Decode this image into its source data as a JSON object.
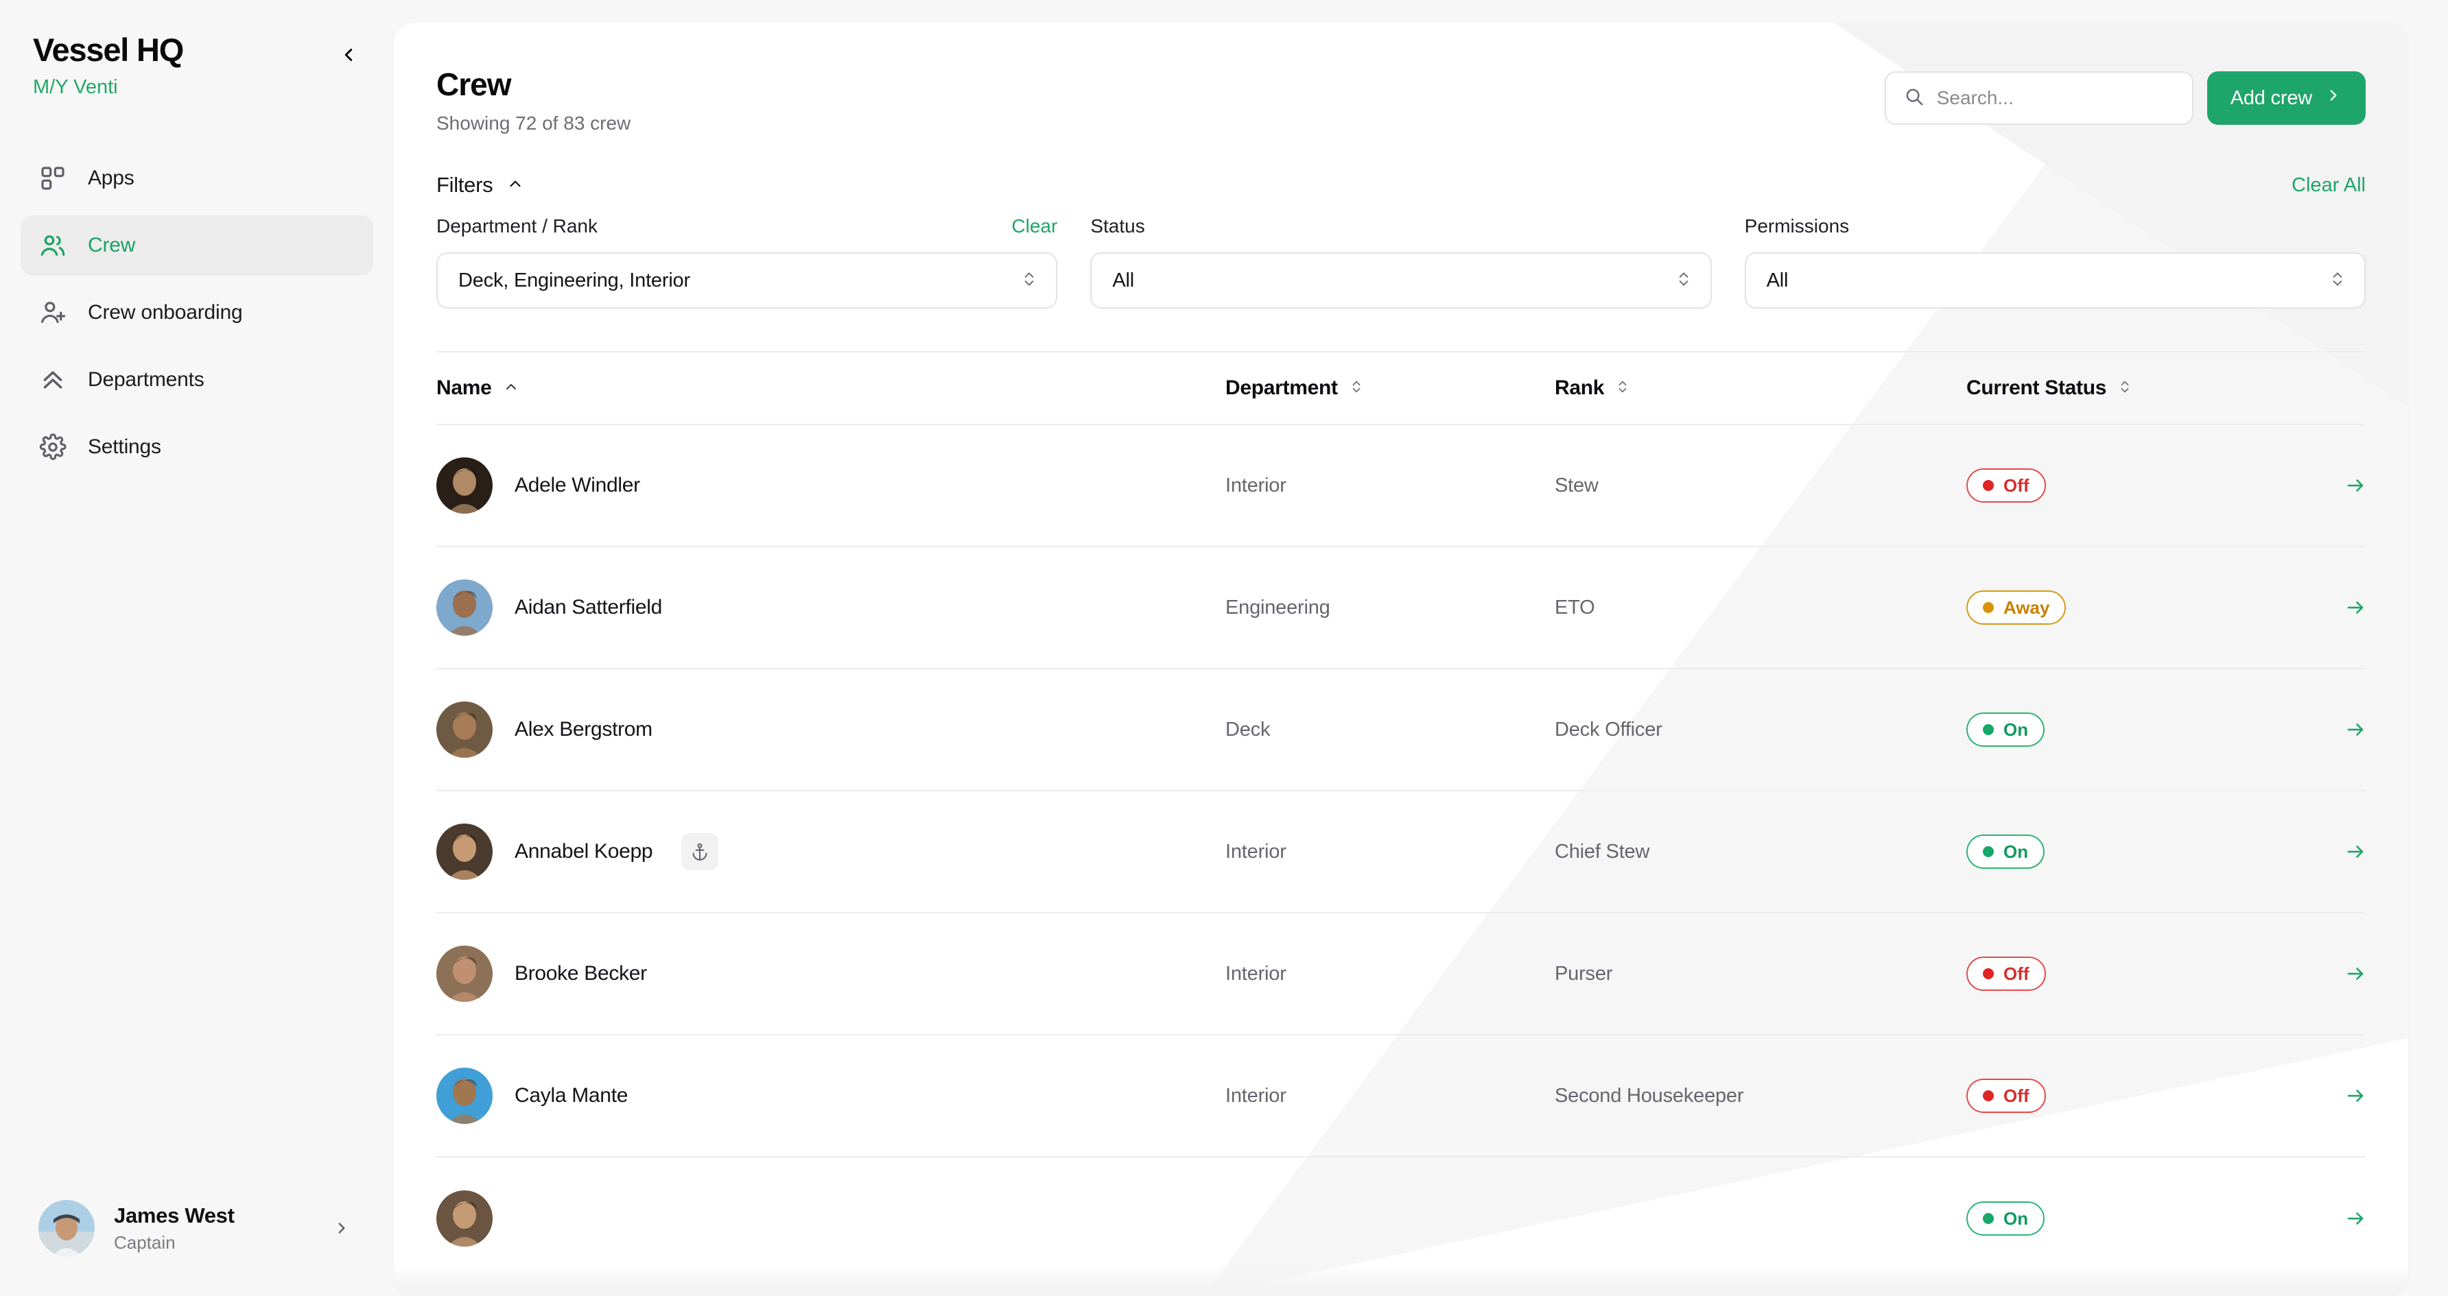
{
  "sidebar": {
    "brand_title": "Vessel HQ",
    "brand_subtitle": "M/Y Venti",
    "collapse_icon": "chevron-left-icon",
    "items": [
      {
        "label": "Apps",
        "icon": "apps-grid-icon",
        "active": false
      },
      {
        "label": "Crew",
        "icon": "users-icon",
        "active": true
      },
      {
        "label": "Crew onboarding",
        "icon": "user-plus-icon",
        "active": false
      },
      {
        "label": "Departments",
        "icon": "double-chevron-up-icon",
        "active": false
      },
      {
        "label": "Settings",
        "icon": "gear-icon",
        "active": false
      }
    ],
    "user": {
      "name": "James West",
      "role": "Captain",
      "chevron_icon": "chevron-right-icon"
    }
  },
  "header": {
    "title": "Crew",
    "subtitle": "Showing 72 of 83 crew",
    "search": {
      "placeholder": "Search...",
      "value": "",
      "icon": "search-icon"
    },
    "add_button": {
      "label": "Add crew",
      "icon": "chevron-right-icon"
    }
  },
  "filters": {
    "label": "Filters",
    "toggle_icon": "chevron-up-icon",
    "clear_all_label": "Clear All",
    "fields": [
      {
        "label": "Department / Rank",
        "clear_label": "Clear",
        "value": "Deck, Engineering, Interior",
        "icon": "chevron-updown-icon"
      },
      {
        "label": "Status",
        "clear_label": "",
        "value": "All",
        "icon": "chevron-updown-icon"
      },
      {
        "label": "Permissions",
        "clear_label": "",
        "value": "All",
        "icon": "chevron-updown-icon"
      }
    ]
  },
  "table": {
    "columns": [
      {
        "label": "Name",
        "sort_icon": "chevron-up-icon",
        "sorted": true
      },
      {
        "label": "Department",
        "sort_icon": "chevron-updown-icon",
        "sorted": false
      },
      {
        "label": "Rank",
        "sort_icon": "chevron-updown-icon",
        "sorted": false
      },
      {
        "label": "Current Status",
        "sort_icon": "chevron-updown-icon",
        "sorted": false
      }
    ],
    "row_arrow_icon": "arrow-right-icon",
    "rows": [
      {
        "name": "Adele Windler",
        "department": "Interior",
        "rank": "Stew",
        "status": "Off",
        "status_kind": "off",
        "badge_icon": null,
        "avatar_tone": "#b08a64",
        "avatar_bg": "#2a1f18"
      },
      {
        "name": "Aidan Satterfield",
        "department": "Engineering",
        "rank": "ETO",
        "status": "Away",
        "status_kind": "away",
        "badge_icon": null,
        "avatar_tone": "#9c6f4e",
        "avatar_bg": "#7ea8cc"
      },
      {
        "name": "Alex Bergstrom",
        "department": "Deck",
        "rank": "Deck Officer",
        "status": "On",
        "status_kind": "on",
        "badge_icon": null,
        "avatar_tone": "#a87c57",
        "avatar_bg": "#6f5b44"
      },
      {
        "name": "Annabel Koepp",
        "department": "Interior",
        "rank": "Chief Stew",
        "status": "On",
        "status_kind": "on",
        "badge_icon": "anchor-icon",
        "avatar_tone": "#c79a73",
        "avatar_bg": "#4b3b2e"
      },
      {
        "name": "Brooke Becker",
        "department": "Interior",
        "rank": "Purser",
        "status": "Off",
        "status_kind": "off",
        "badge_icon": null,
        "avatar_tone": "#c09071",
        "avatar_bg": "#8d7157"
      },
      {
        "name": "Cayla Mante",
        "department": "Interior",
        "rank": "Second Housekeeper",
        "status": "Off",
        "status_kind": "off",
        "badge_icon": null,
        "avatar_tone": "#a2764f",
        "avatar_bg": "#3f9fd6"
      },
      {
        "name": "",
        "department": "",
        "rank": "",
        "status": "On",
        "status_kind": "on",
        "badge_icon": null,
        "avatar_tone": "#c49b74",
        "avatar_bg": "#6b5440"
      }
    ]
  },
  "colors": {
    "accent_green": "#1ea56a",
    "status_on": "#15a867",
    "status_off": "#e02424",
    "status_away": "#d99206",
    "page_bg": "#f7f7f7",
    "card_bg": "#ffffff",
    "border": "#ececee"
  }
}
